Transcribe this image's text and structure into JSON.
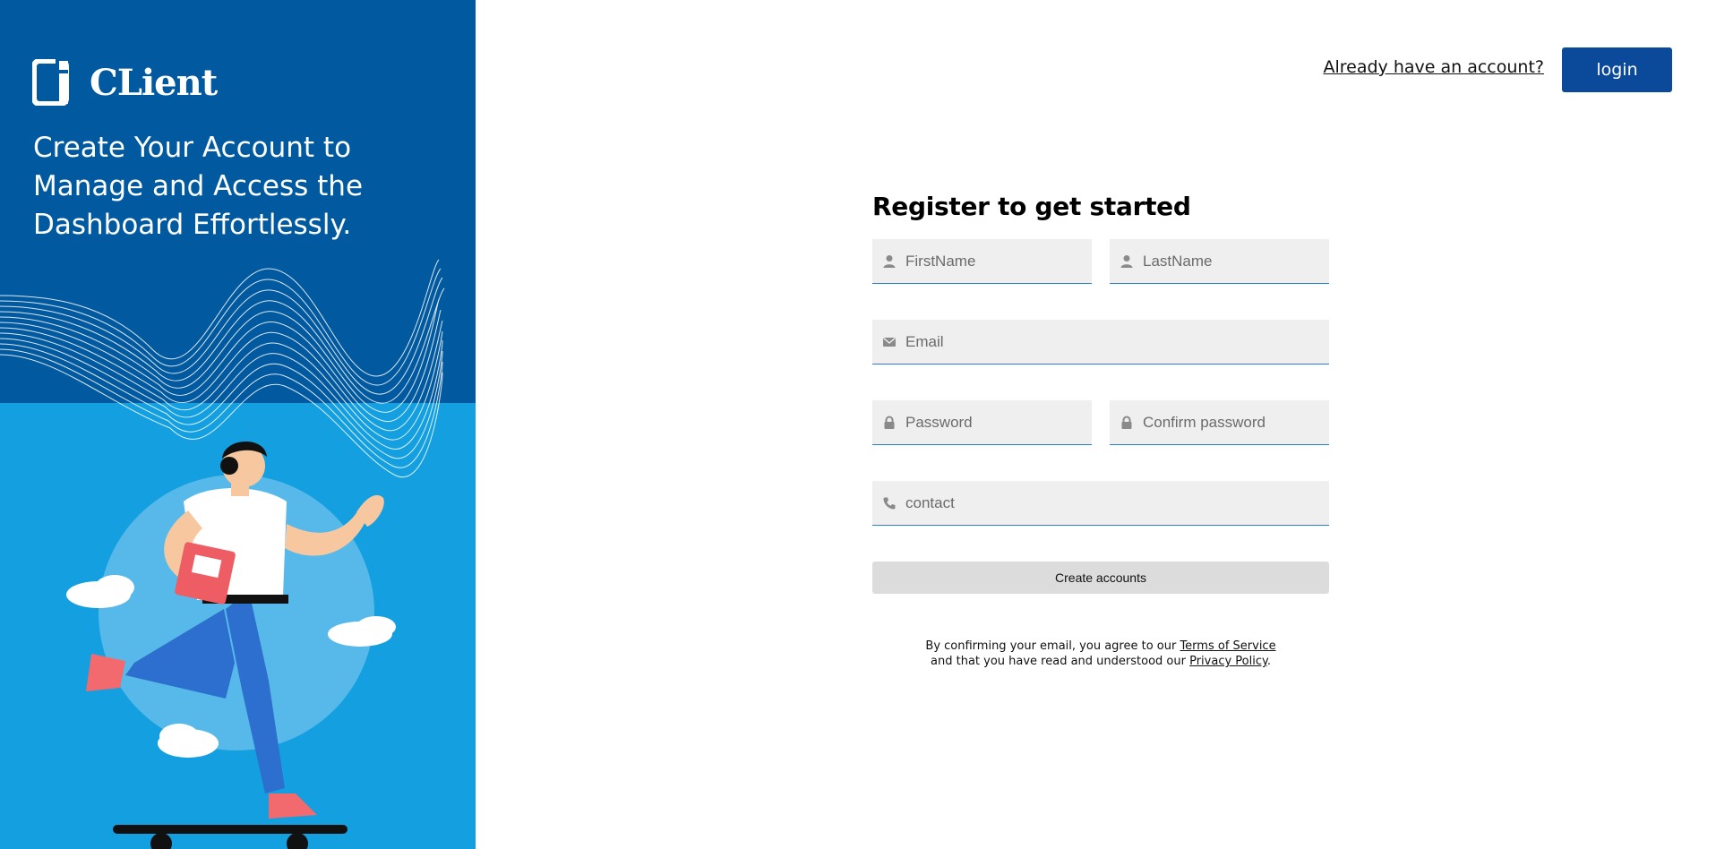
{
  "brand": {
    "name": "CLient",
    "tagline": "Create Your Account to Manage and Access the Dashboard Effortlessly."
  },
  "header": {
    "already_account_link": "Already have an account?",
    "login_label": "login"
  },
  "form": {
    "title": "Register to get started",
    "first_name": {
      "placeholder": "FirstName",
      "icon": "user-icon"
    },
    "last_name": {
      "placeholder": "LastName",
      "icon": "user-icon"
    },
    "email": {
      "placeholder": "Email",
      "icon": "envelope-icon"
    },
    "password": {
      "placeholder": "Password",
      "icon": "lock-icon"
    },
    "confirm_password": {
      "placeholder": "Confirm password",
      "icon": "lock-icon"
    },
    "contact": {
      "placeholder": "contact",
      "icon": "phone-icon"
    },
    "submit_label": "Create accounts"
  },
  "terms": {
    "line1_prefix": "By confirming your email, you agree to our ",
    "terms_link": "Terms of Service",
    "line2_prefix": "and that you have read and understood our ",
    "privacy_link": "Privacy Policy",
    "line2_suffix": "."
  },
  "colors": {
    "hero_dark": "#0159a0",
    "hero_light": "#139fe0",
    "login_button": "#0b4a9b",
    "field_underline": "#2a7fd4"
  }
}
